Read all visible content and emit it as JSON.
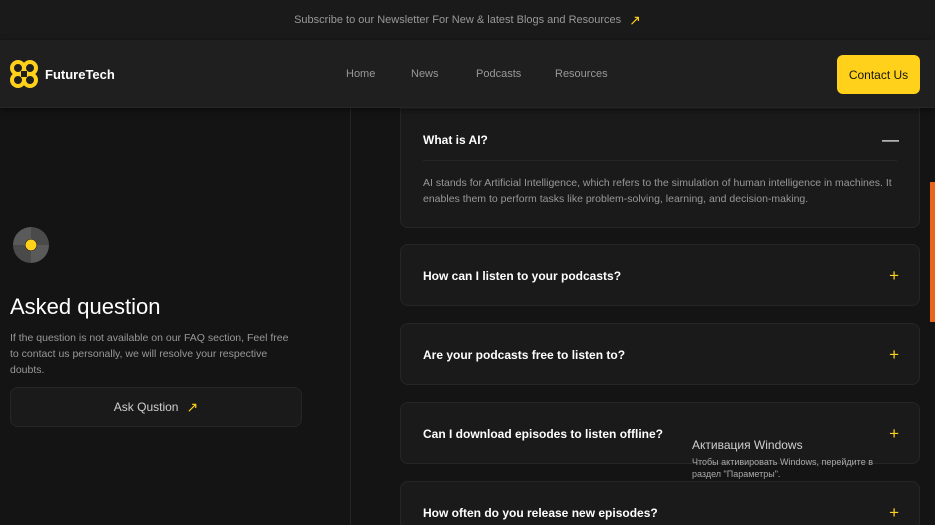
{
  "banner": {
    "text": "Subscribe to our Newsletter For New & latest Blogs and Resources",
    "arrow": "↗"
  },
  "header": {
    "brand": "FutureTech",
    "nav": [
      "Home",
      "News",
      "Podcasts",
      "Resources"
    ],
    "contact_label": "Contact Us"
  },
  "left": {
    "title": "Asked question",
    "description": "If the question is not available on our FAQ section, Feel free to contact us personally, we will resolve your respective doubts.",
    "ask_label": "Ask Qustion",
    "ask_arrow": "↗"
  },
  "faq": [
    {
      "question": "What is AI?",
      "answer": "AI stands for Artificial Intelligence, which refers to the simulation of human intelligence in machines. It enables them to perform tasks like problem-solving, learning, and decision-making.",
      "toggle": "—",
      "expanded": true
    },
    {
      "question": "How can I listen to your podcasts?",
      "toggle": "+",
      "expanded": false
    },
    {
      "question": "Are your podcasts free to listen to?",
      "toggle": "+",
      "expanded": false
    },
    {
      "question": "Can I download episodes to listen offline?",
      "toggle": "+",
      "expanded": false
    },
    {
      "question": "How often do you release new episodes?",
      "toggle": "+",
      "expanded": false
    }
  ],
  "watermark": {
    "title": "Активация Windows",
    "subtitle": "Чтобы активировать Windows, перейдите в раздел \"Параметры\"."
  },
  "colors": {
    "accent": "#ffd11a",
    "background": "#141414",
    "card": "#1a1a1a",
    "muted": "#98989a",
    "scrollbar": "#e8641a"
  },
  "icons": {
    "brand": "futuretech-logo-icon",
    "faq_symbol": "spinner-symbol-icon"
  }
}
